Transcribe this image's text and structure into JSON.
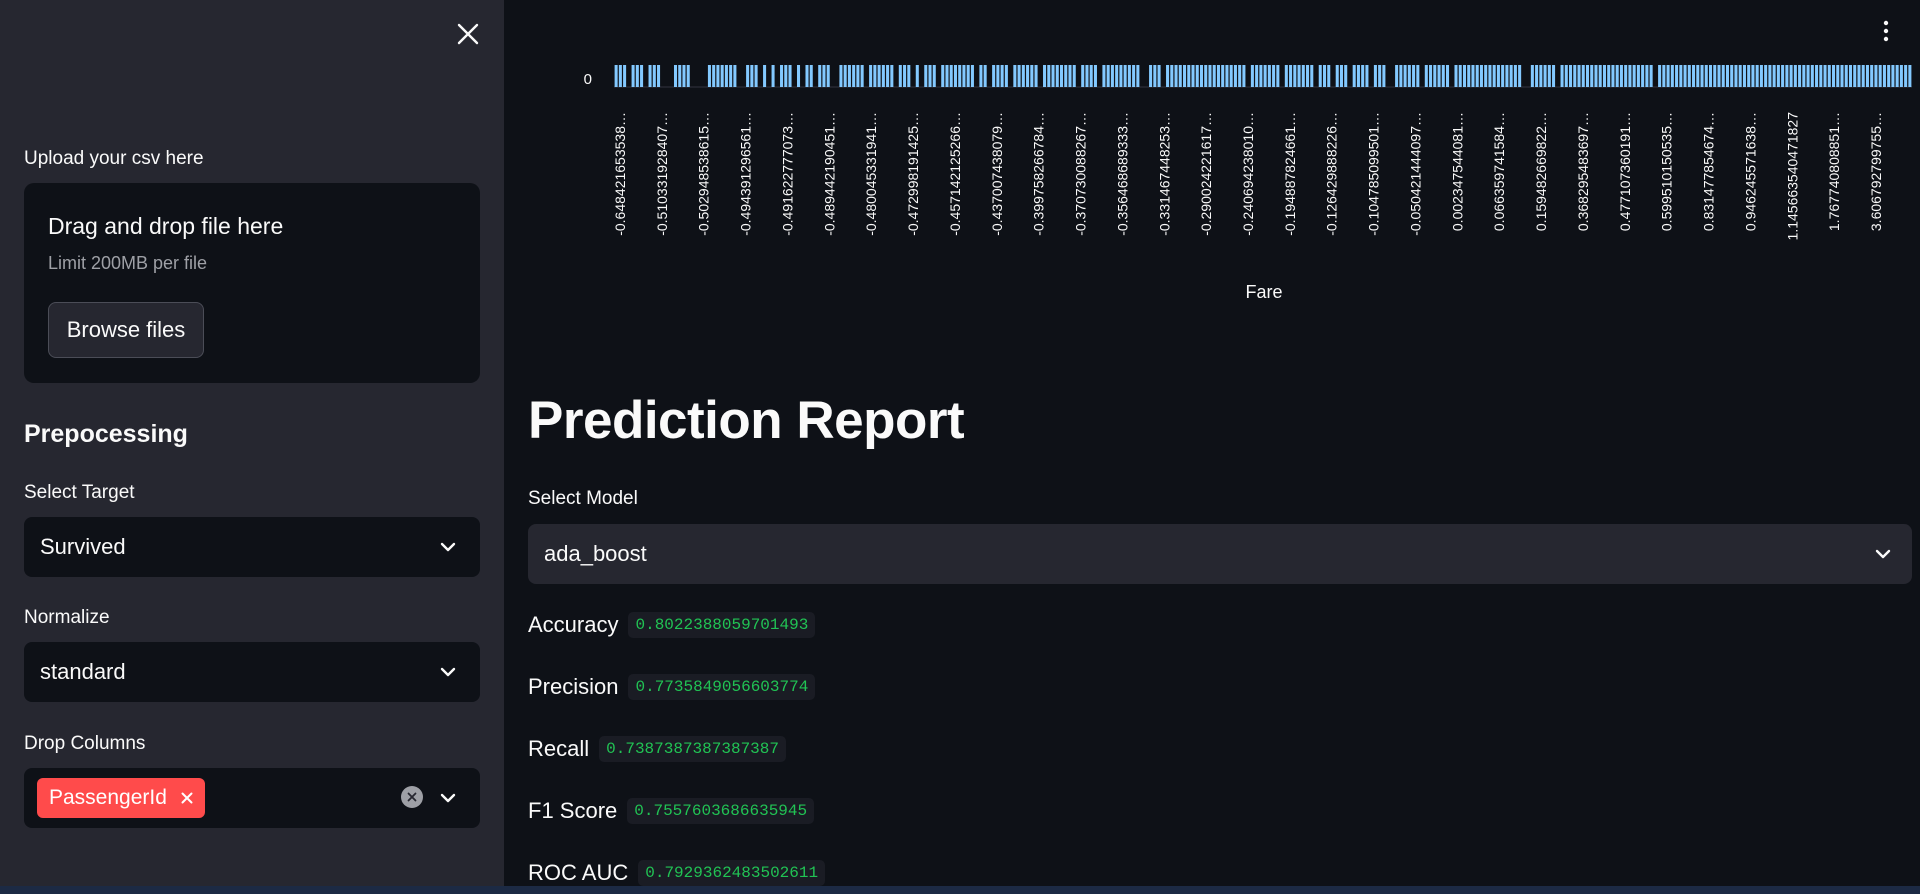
{
  "sidebar": {
    "close_icon": "close-icon",
    "upload": {
      "label": "Upload your csv here",
      "title": "Drag and drop file here",
      "limit": "Limit 200MB per file",
      "browse_label": "Browse files"
    },
    "heading": "Prepocessing",
    "target": {
      "label": "Select Target",
      "value": "Survived"
    },
    "normalize": {
      "label": "Normalize",
      "value": "standard"
    },
    "drop_columns": {
      "label": "Drop Columns",
      "tags": [
        "PassengerId"
      ]
    }
  },
  "main": {
    "menu_icon": "more-vertical-icon",
    "title": "Prediction Report",
    "model": {
      "label": "Select Model",
      "value": "ada_boost"
    },
    "metrics": [
      {
        "name": "Accuracy",
        "value": "0.8022388059701493"
      },
      {
        "name": "Precision",
        "value": "0.7735849056603774"
      },
      {
        "name": "Recall",
        "value": "0.7387387387387387"
      },
      {
        "name": "F1 Score",
        "value": "0.7557603686635945"
      },
      {
        "name": "ROC AUC",
        "value": "0.7929362483502611"
      }
    ]
  },
  "chart_data": {
    "type": "bar",
    "xlabel": "Fare",
    "ylabel": "",
    "y_tick_labels": [
      "0"
    ],
    "bar_color": "#83c9ff",
    "categories": [
      "-0.648421653538…",
      "-0.510331928407…",
      "-0.502948538615…",
      "-0.494391296561…",
      "-0.491622777073…",
      "-0.489442190451…",
      "-0.480045331941…",
      "-0.472998191425…",
      "-0.457142125266…",
      "-0.437007438079…",
      "-0.399758266784…",
      "-0.370730088267…",
      "-0.356468689333…",
      "-0.331467448253…",
      "-0.290024221617…",
      "-0.240694238010…",
      "-0.194887824661…",
      "-0.126429888226…",
      "-0.104785099501…",
      "-0.050421444097…",
      "0.002347544081…",
      "0.066359741584…",
      "0.159482669822…",
      "0.368295483697…",
      "0.477107360191…",
      "0.599510150535…",
      "0.831477854674…",
      "0.946245571638…",
      "1.145663540471827",
      "1.767740808851…",
      "3.606792799755…"
    ],
    "bar_presence": "111011101110001111000011111110011101010111010110111001111110111111011101011101111111101101111011111101111111101111011111111100111011111111111111111110111111101111111011101110111101110011111101111110111111111111111100111111011111111111111111111110111111111111111111111111111111111111111111111111111111111111"
  }
}
